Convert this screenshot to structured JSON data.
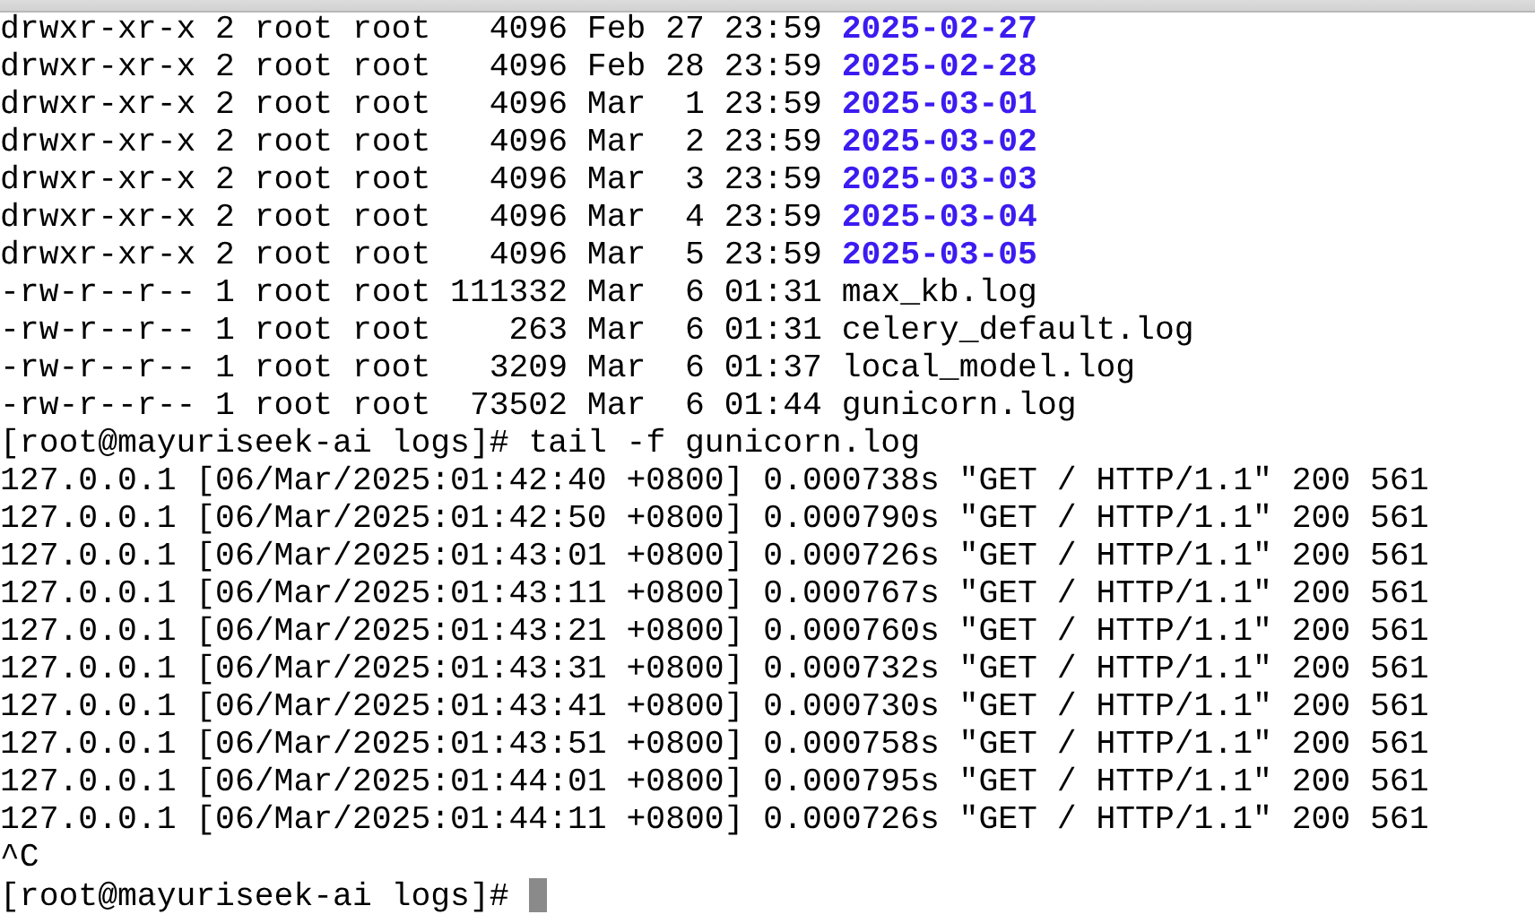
{
  "terminal": {
    "listing": [
      {
        "kind": "directory",
        "info": "drwxr-xr-x 2 root root   4096 Feb 27 23:59",
        "name": "2025-02-27"
      },
      {
        "kind": "directory",
        "info": "drwxr-xr-x 2 root root   4096 Feb 28 23:59",
        "name": "2025-02-28"
      },
      {
        "kind": "directory",
        "info": "drwxr-xr-x 2 root root   4096 Mar  1 23:59",
        "name": "2025-03-01"
      },
      {
        "kind": "directory",
        "info": "drwxr-xr-x 2 root root   4096 Mar  2 23:59",
        "name": "2025-03-02"
      },
      {
        "kind": "directory",
        "info": "drwxr-xr-x 2 root root   4096 Mar  3 23:59",
        "name": "2025-03-03"
      },
      {
        "kind": "directory",
        "info": "drwxr-xr-x 2 root root   4096 Mar  4 23:59",
        "name": "2025-03-04"
      },
      {
        "kind": "directory",
        "info": "drwxr-xr-x 2 root root   4096 Mar  5 23:59",
        "name": "2025-03-05"
      },
      {
        "kind": "file",
        "info": "-rw-r--r-- 1 root root 111332 Mar  6 01:31",
        "name": "max_kb.log"
      },
      {
        "kind": "file",
        "info": "-rw-r--r-- 1 root root    263 Mar  6 01:31",
        "name": "celery_default.log"
      },
      {
        "kind": "file",
        "info": "-rw-r--r-- 1 root root   3209 Mar  6 01:37",
        "name": "local_model.log"
      },
      {
        "kind": "file",
        "info": "-rw-r--r-- 1 root root  73502 Mar  6 01:44",
        "name": "gunicorn.log"
      }
    ],
    "command_prompt": {
      "prompt": "[root@mayuriseek-ai logs]#",
      "command": "tail -f gunicorn.log"
    },
    "log_lines": [
      "127.0.0.1 [06/Mar/2025:01:42:40 +0800] 0.000738s \"GET / HTTP/1.1\" 200 561",
      "127.0.0.1 [06/Mar/2025:01:42:50 +0800] 0.000790s \"GET / HTTP/1.1\" 200 561",
      "127.0.0.1 [06/Mar/2025:01:43:01 +0800] 0.000726s \"GET / HTTP/1.1\" 200 561",
      "127.0.0.1 [06/Mar/2025:01:43:11 +0800] 0.000767s \"GET / HTTP/1.1\" 200 561",
      "127.0.0.1 [06/Mar/2025:01:43:21 +0800] 0.000760s \"GET / HTTP/1.1\" 200 561",
      "127.0.0.1 [06/Mar/2025:01:43:31 +0800] 0.000732s \"GET / HTTP/1.1\" 200 561",
      "127.0.0.1 [06/Mar/2025:01:43:41 +0800] 0.000730s \"GET / HTTP/1.1\" 200 561",
      "127.0.0.1 [06/Mar/2025:01:43:51 +0800] 0.000758s \"GET / HTTP/1.1\" 200 561",
      "127.0.0.1 [06/Mar/2025:01:44:01 +0800] 0.000795s \"GET / HTTP/1.1\" 200 561",
      "127.0.0.1 [06/Mar/2025:01:44:11 +0800] 0.000726s \"GET / HTTP/1.1\" 200 561"
    ],
    "interrupt": "^C",
    "final_prompt": {
      "prompt": "[root@mayuriseek-ai logs]#"
    }
  }
}
